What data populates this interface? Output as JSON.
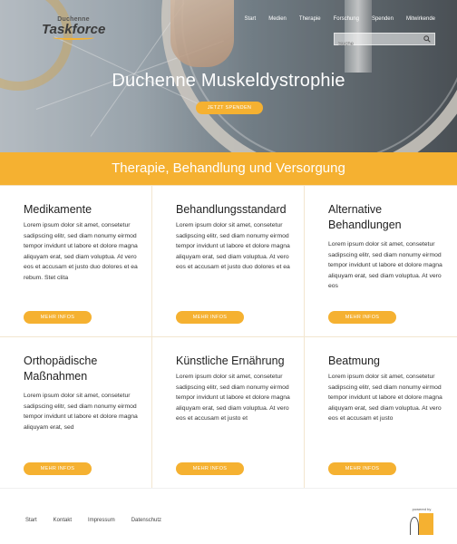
{
  "header": {
    "logo_line1": "Duchenne",
    "logo_line2": "Taskforce",
    "nav": [
      "Start",
      "Medien",
      "Therapie",
      "Forschung",
      "Spenden",
      "Mitwirkende"
    ],
    "search": {
      "placeholder": "Suche",
      "value": ""
    }
  },
  "hero": {
    "title": "Duchenne Muskeldystrophie",
    "button": "JETZT SPENDEN"
  },
  "section": {
    "title": "Therapie, Behandlung und Versorgung"
  },
  "cards": [
    {
      "title": "Medikamente",
      "text": "Lorem ipsum dolor sit amet, consetetur sadipscing elitr, sed diam nonumy eirmod tempor invidunt ut labore et dolore magna aliquyam erat, sed diam voluptua. At vero eos et accusam et justo duo dolores et ea rebum. Stet clita",
      "button": "MEHR INFOS"
    },
    {
      "title": "Behandlungsstandard",
      "text": "Lorem ipsum dolor sit amet, consetetur sadipscing elitr, sed diam nonumy eirmod tempor invidunt ut labore et dolore magna aliquyam erat, sed diam voluptua. At vero eos et accusam et justo duo dolores et ea",
      "button": "MEHR INFOS"
    },
    {
      "title": "Alternative Behandlungen",
      "text": "Lorem ipsum dolor sit amet, consetetur sadipscing elitr, sed diam nonumy eirmod tempor invidunt ut labore et dolore magna aliquyam erat, sed diam voluptua. At vero eos",
      "button": "MEHR INFOS"
    },
    {
      "title": "Orthopädische Maßnahmen",
      "text": "Lorem ipsum dolor sit amet, consetetur sadipscing elitr, sed diam nonumy eirmod tempor invidunt ut labore et dolore magna aliquyam erat, sed",
      "button": "MEHR INFOS"
    },
    {
      "title": "Künstliche Ernährung",
      "text": "Lorem ipsum dolor sit amet, consetetur sadipscing elitr, sed diam nonumy eirmod tempor invidunt ut labore et dolore magna aliquyam erat, sed diam voluptua. At vero eos et accusam et justo et",
      "button": "MEHR INFOS"
    },
    {
      "title": "Beatmung",
      "text": "Lorem ipsum dolor sit amet, consetetur sadipscing elitr, sed diam nonumy eirmod tempor invidunt ut labore et dolore magna aliquyam erat, sed diam voluptua. At vero eos et accusam et justo",
      "button": "MEHR INFOS"
    }
  ],
  "footer": {
    "links": [
      "Start",
      "Kontakt",
      "Impressum",
      "Datenschutz"
    ],
    "powered_by": "powered by"
  },
  "colors": {
    "accent": "#f5b131",
    "text": "#333333"
  }
}
